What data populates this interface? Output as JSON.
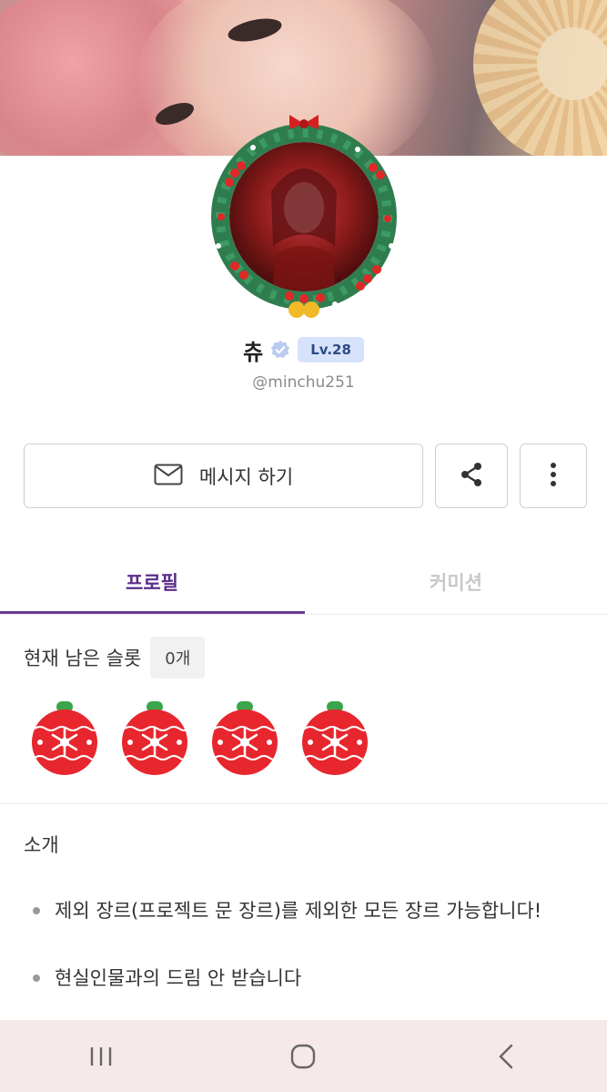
{
  "profile": {
    "name": "츄",
    "level": "Lv.28",
    "handle": "@minchu251"
  },
  "actions": {
    "message_label": "메시지 하기"
  },
  "tabs": [
    {
      "label": "프로필",
      "active": true
    },
    {
      "label": "커미션",
      "active": false
    }
  ],
  "slots": {
    "label": "현재 남은 슬롯",
    "count": "0개",
    "ornament_count": 4
  },
  "intro": {
    "title": "소개",
    "bullets": [
      "제외 장르(프로젝트 문 장르)를 제외한 모든 장르 가능합니다!",
      "현실인물과의 드림 안 받습니다"
    ]
  },
  "colors": {
    "accent": "#6a3a96",
    "level_bg": "#d7e3fb",
    "navbar_bg": "#f6e9ea"
  }
}
